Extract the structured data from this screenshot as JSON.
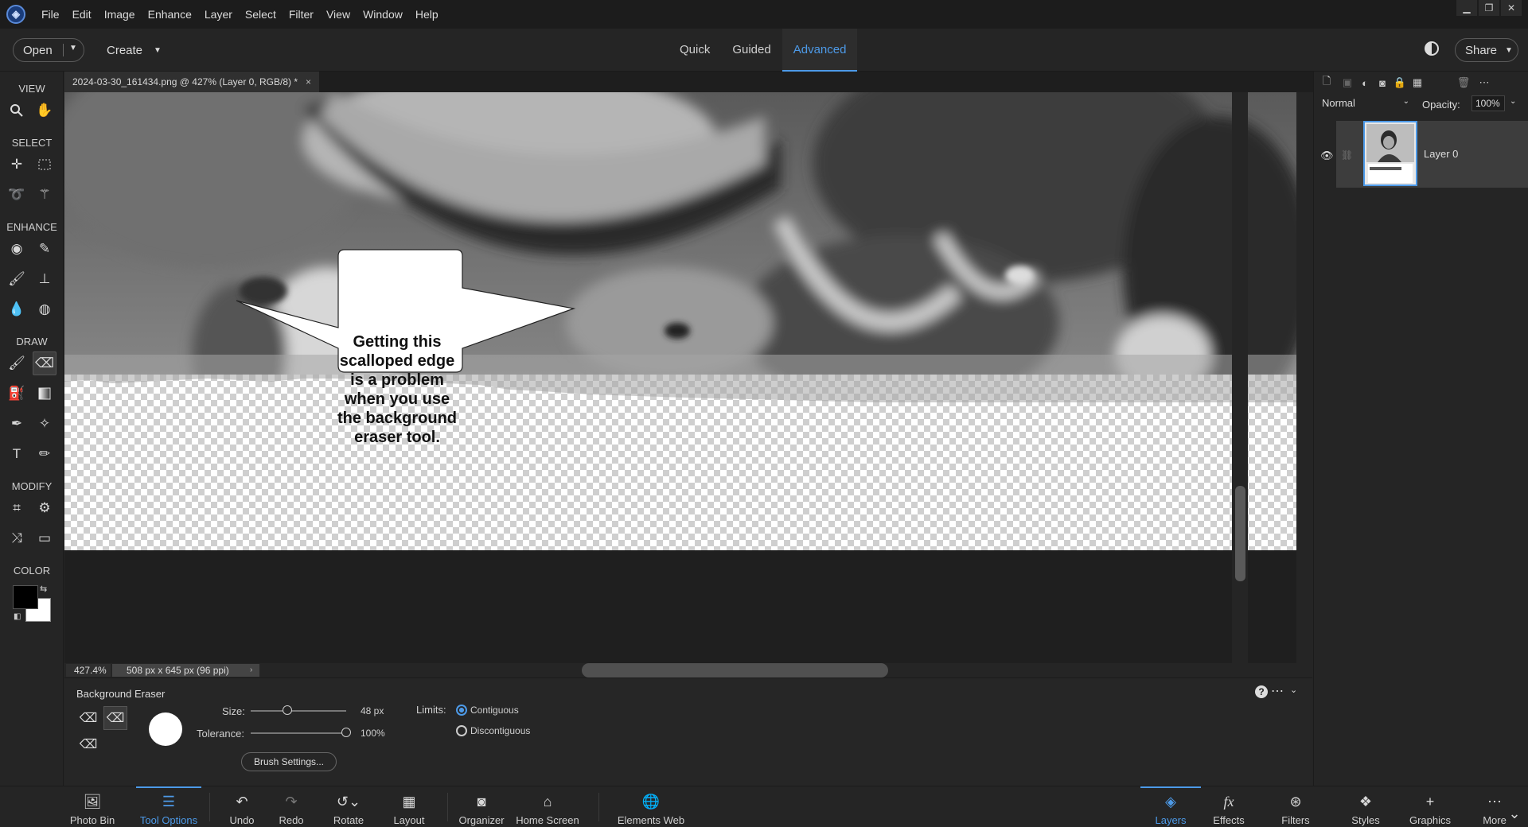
{
  "menubar": {
    "items": [
      "File",
      "Edit",
      "Image",
      "Enhance",
      "Layer",
      "Select",
      "Filter",
      "View",
      "Window",
      "Help"
    ]
  },
  "topbar": {
    "open_label": "Open",
    "create_label": "Create",
    "modes": [
      "Quick",
      "Guided",
      "Advanced"
    ],
    "active_mode": "Advanced",
    "share_label": "Share"
  },
  "toolbox": {
    "sections": [
      "VIEW",
      "SELECT",
      "ENHANCE",
      "DRAW",
      "MODIFY",
      "COLOR"
    ],
    "foreground_color": "#000000",
    "background_color": "#ffffff",
    "active_tool": "background-eraser"
  },
  "document": {
    "tab_title": "2024-03-30_161434.png @ 427% (Layer 0, RGB/8) *",
    "close_glyph": "×",
    "callout_text": "Getting this scalloped edge is a problem when you use the background eraser tool."
  },
  "status": {
    "zoom": "427.4%",
    "doc_size": "508 px x 645 px (96 ppi)"
  },
  "layers": {
    "blend_mode": "Normal",
    "opacity_label": "Opacity:",
    "opacity_value": "100%",
    "items": [
      {
        "name": "Layer 0",
        "visible": true
      }
    ]
  },
  "tool_options": {
    "title": "Background Eraser",
    "size_label": "Size:",
    "size_value": "48 px",
    "size_fraction": 0.38,
    "tolerance_label": "Tolerance:",
    "tolerance_value": "100%",
    "tolerance_fraction": 1.0,
    "brush_settings_label": "Brush Settings...",
    "limits_label": "Limits:",
    "limits_options": [
      "Contiguous",
      "Discontiguous"
    ],
    "limits_selected": "Contiguous"
  },
  "bottombar": {
    "left": [
      "Photo Bin",
      "Tool Options",
      "Undo",
      "Redo",
      "Rotate",
      "Layout",
      "Organizer",
      "Home Screen",
      "Elements Web"
    ],
    "right": [
      "Layers",
      "Effects",
      "Filters",
      "Styles",
      "Graphics",
      "More"
    ],
    "active_left": "Tool Options",
    "active_right": "Layers"
  },
  "colors": {
    "accent": "#4d9ae8"
  }
}
